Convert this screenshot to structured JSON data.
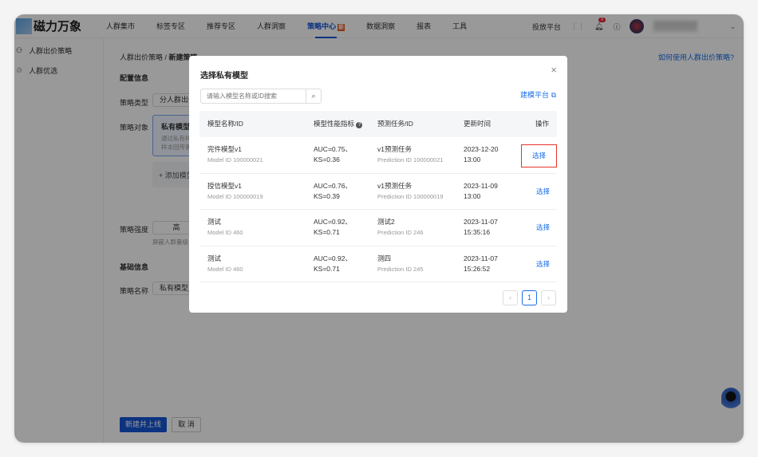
{
  "header": {
    "logo": "磁力万象",
    "nav": [
      "人群集市",
      "标签专区",
      "推荐专区",
      "人群洞察",
      "策略中心",
      "数据洞察",
      "报表",
      "工具"
    ],
    "new_badge": "新",
    "active_nav": "策略中心",
    "platform": "投放平台",
    "notif_count": "9"
  },
  "sidebar": {
    "items": [
      {
        "label": "人群出价策略",
        "icon": "people-icon"
      },
      {
        "label": "人群优选",
        "icon": "filter-icon"
      }
    ]
  },
  "main": {
    "breadcrumb": [
      "人群出价策略",
      "新建策略"
    ],
    "help_link": "如何使用人群出价策略?",
    "section_config": "配置信息",
    "type_label": "策略类型",
    "type_value": "分人群出价",
    "target_label": "策略对象",
    "card_title": "私有模型",
    "card_desc1": "通过私有样",
    "card_desc2": "样本回传客",
    "add_model": "+ 添加模型",
    "strength_label": "策略强度",
    "strength_value": "高",
    "strength_hint": "屏蔽人群量级",
    "section_basic": "基础信息",
    "name_label": "策略名称",
    "name_value": "私有模型_",
    "submit": "新建并上线",
    "cancel": "取 消"
  },
  "modal": {
    "title": "选择私有模型",
    "search_placeholder": "请输入模型名称或ID搜索",
    "platform_link": "建模平台",
    "columns": [
      "模型名称/ID",
      "模型性能指标",
      "预测任务/ID",
      "更新时间",
      "操作"
    ],
    "rows": [
      {
        "name": "完件模型v1",
        "model_id": "Model ID 100000021",
        "metric1": "AUC=0.75、",
        "metric2": "KS=0.36",
        "task": "v1预测任务",
        "task_id": "Prediction ID 100000021",
        "date": "2023-12-20",
        "time": "13:00",
        "action": "选择"
      },
      {
        "name": "授信模型v1",
        "model_id": "Model ID 100000019",
        "metric1": "AUC=0.76、",
        "metric2": "KS=0.39",
        "task": "v1预测任务",
        "task_id": "Prediction ID 100000019",
        "date": "2023-11-09",
        "time": "13:00",
        "action": "选择"
      },
      {
        "name": "测试",
        "model_id": "Model ID 460",
        "metric1": "AUC=0.92、",
        "metric2": "KS=0.71",
        "task": "测试2",
        "task_id": "Prediction ID 246",
        "date": "2023-11-07",
        "time": "15:35:16",
        "action": "选择"
      },
      {
        "name": "测试",
        "model_id": "Model ID 460",
        "metric1": "AUC=0.92、",
        "metric2": "KS=0.71",
        "task": "测四",
        "task_id": "Prediction ID 245",
        "date": "2023-11-07",
        "time": "15:26:52",
        "action": "选择"
      }
    ],
    "page": "1",
    "highlight_color": "#e8322b"
  }
}
